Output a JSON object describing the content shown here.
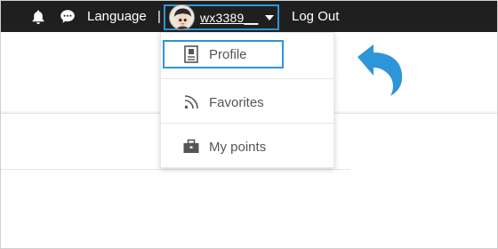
{
  "topbar": {
    "icons": [
      "bell-icon",
      "chat-icon"
    ],
    "language_label": "Language",
    "separator": "|",
    "username": "wx3389__",
    "logout_label": "Log Out"
  },
  "dropdown": {
    "items": [
      {
        "label": "Profile",
        "icon": "profile-card-icon"
      },
      {
        "label": "Favorites",
        "icon": "rss-icon"
      },
      {
        "label": "My points",
        "icon": "briefcase-icon"
      }
    ]
  },
  "colors": {
    "topbar_bg": "#1f1f1f",
    "highlight": "#2d96d8",
    "menu_text": "#555555"
  }
}
